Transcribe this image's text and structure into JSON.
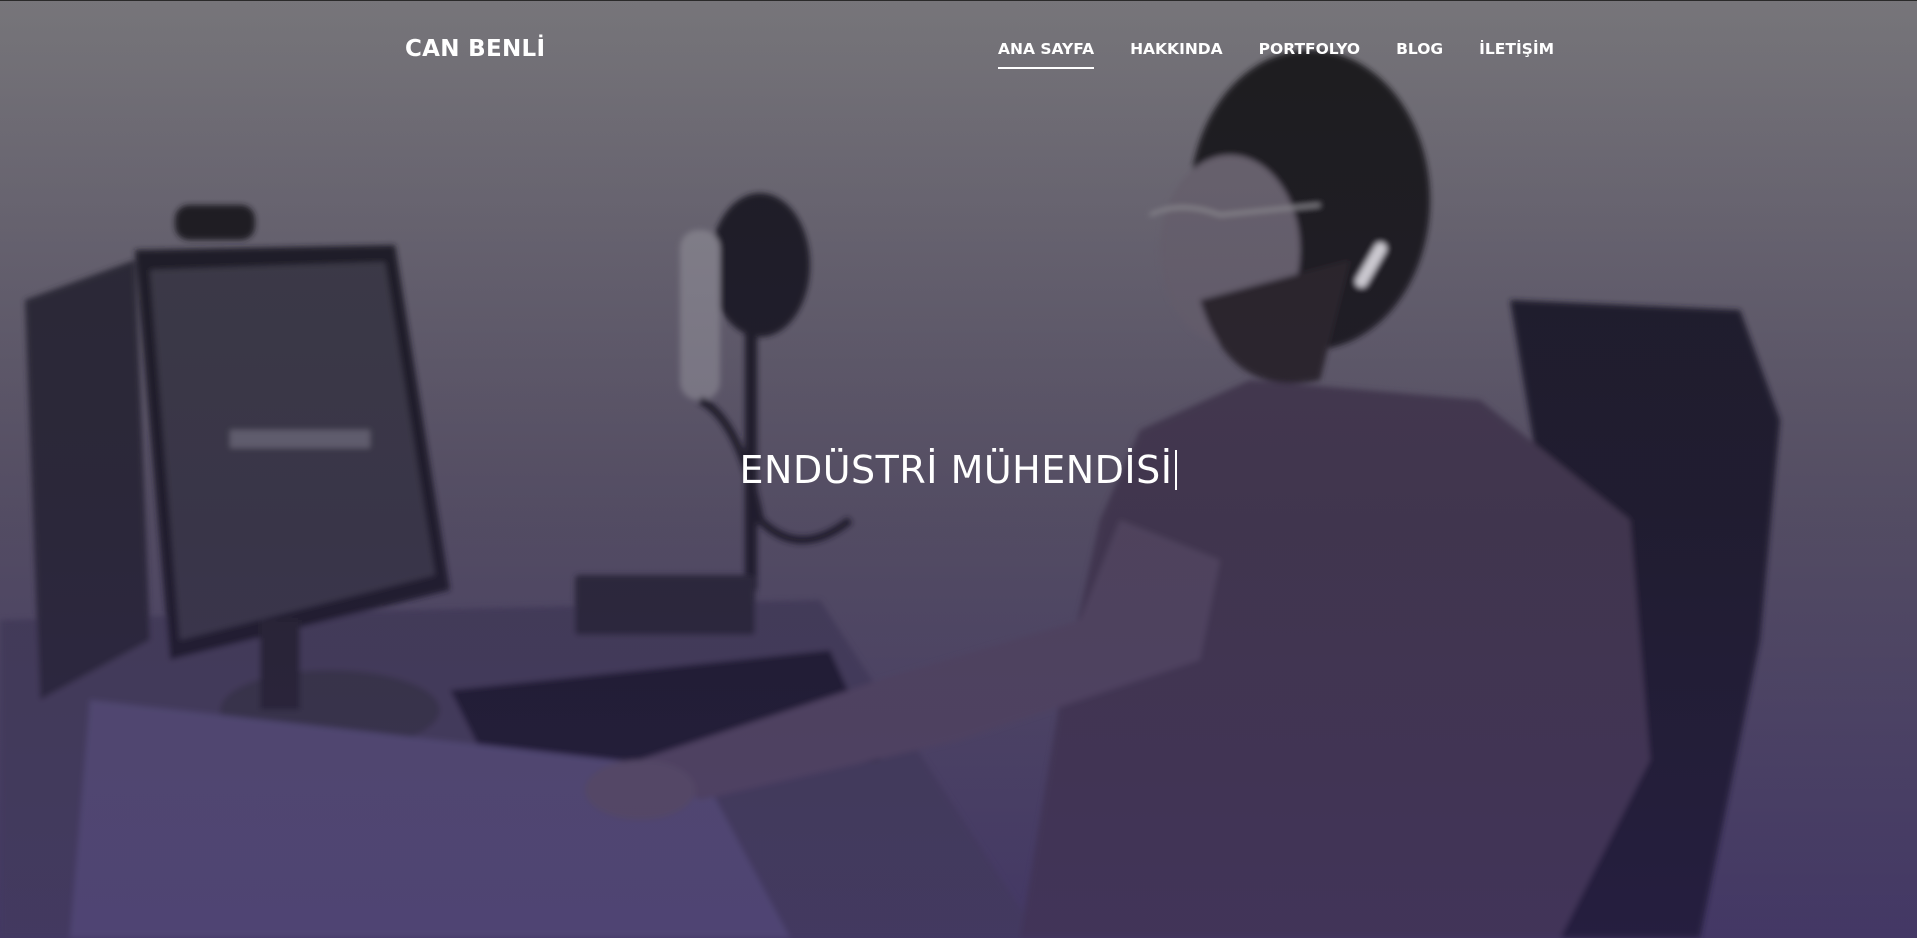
{
  "brand": {
    "name": "CAN BENLİ"
  },
  "nav": {
    "items": [
      {
        "label": "ANA SAYFA",
        "active": true
      },
      {
        "label": "HAKKINDA",
        "active": false
      },
      {
        "label": "PORTFOLYO",
        "active": false
      },
      {
        "label": "BLOG",
        "active": false
      },
      {
        "label": "İLETİŞİM",
        "active": false
      }
    ]
  },
  "hero": {
    "typed_text": "ENDÜSTRİ MÜHENDİSİ",
    "background_image": "man-working-at-desk-photo"
  },
  "colors": {
    "text": "#ffffff",
    "overlay_tint": "#3a2d5c"
  }
}
